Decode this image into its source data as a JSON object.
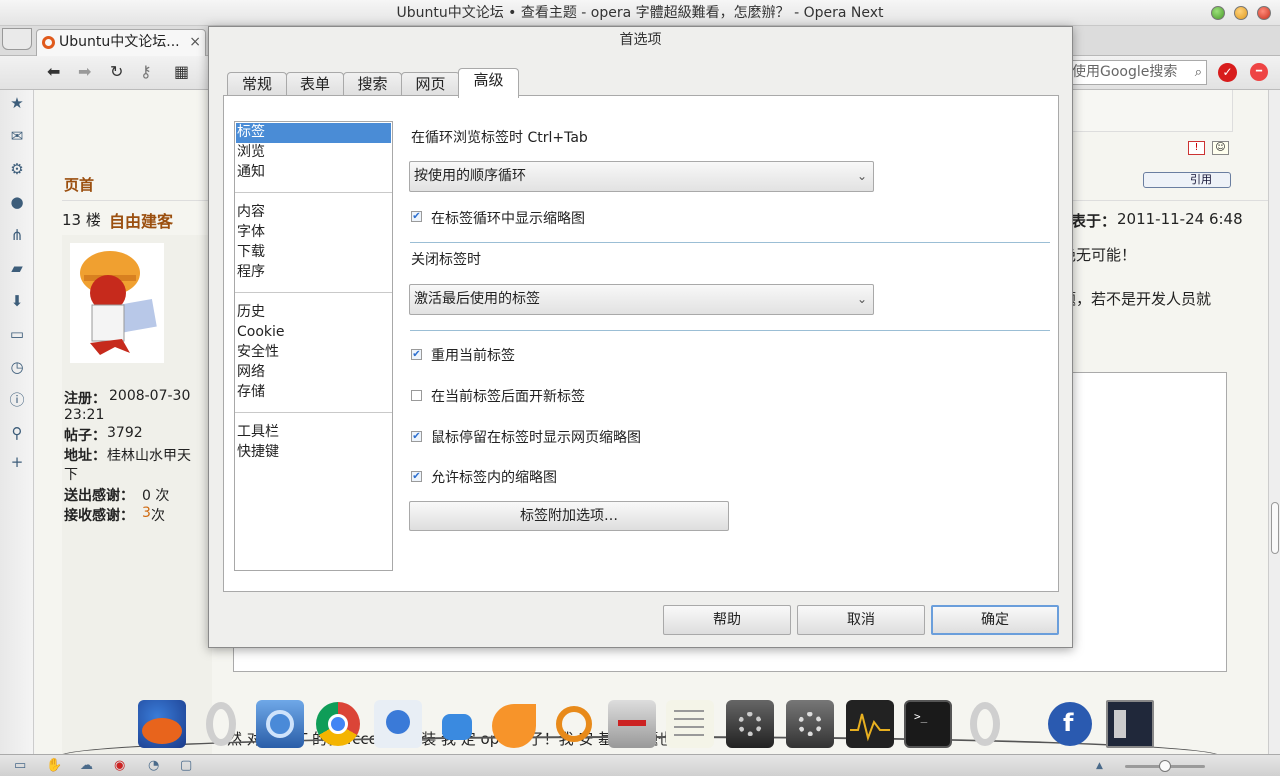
{
  "window": {
    "title": "Ubuntu中文论坛 • 查看主题 - opera 字體超級難看，怎麼辦？ - Opera Next"
  },
  "tab": {
    "label": "Ubuntu中文论坛...",
    "close": "×"
  },
  "toolbar": {
    "search_placeholder": "使用Google搜索"
  },
  "page": {
    "header_left": "页首",
    "quote_button": "引用",
    "floor": "13 楼",
    "author": "自由建客",
    "posted_label": "表于：",
    "posted_date": "2011-11-24 6:48",
    "body_line1": "绝无可能！",
    "body_line2": "题，若不是开发人员就",
    "bottom_text": "然       对       版      QT    的就     fcconfi          择       装      我      定      opera   了！我      安     基本问题也",
    "user": {
      "register_label": "注册：",
      "register_value": "2008-07-30",
      "register_time": "23:21",
      "posts_label": "帖子：",
      "posts_value": "3792",
      "address_label": "地址：",
      "address_value": "桂林山水甲天",
      "address_value2": "下",
      "thanks_given_label": "送出感谢：",
      "thanks_given_value": "0 次",
      "thanks_recv_label": "接收感谢：",
      "thanks_recv_value": "3",
      "thanks_recv_unit": " 次"
    }
  },
  "dialog": {
    "title": "首选项",
    "tabs": [
      "常规",
      "表单",
      "搜索",
      "网页",
      "高级"
    ],
    "active_tab": "高级",
    "categories": {
      "group1": [
        "标签",
        "浏览",
        "通知"
      ],
      "group2": [
        "内容",
        "字体",
        "下载",
        "程序"
      ],
      "group3": [
        "历史",
        "Cookie",
        "安全性",
        "网络",
        "存储"
      ],
      "group4": [
        "工具栏",
        "快捷键"
      ]
    },
    "selected_category": "标签",
    "cycle_label": "在循环浏览标签时 Ctrl+Tab",
    "cycle_select": "按使用的顺序循环",
    "show_thumbnails_cycle": {
      "label": "在标签循环中显示缩略图",
      "checked": true
    },
    "close_label": "关闭标签时",
    "close_select": "激活最后使用的标签",
    "checkboxes": [
      {
        "label": "重用当前标签",
        "checked": true
      },
      {
        "label": "在当前标签后面开新标签",
        "checked": false
      },
      {
        "label": "鼠标停留在标签时显示网页缩略图",
        "checked": true
      },
      {
        "label": "允许标签内的缩略图",
        "checked": true
      }
    ],
    "extra_button": "标签附加选项…",
    "help_button": "帮助",
    "cancel_button": "取消",
    "ok_button": "确定"
  },
  "dock": {
    "icons": [
      "firefox-icon",
      "opera-icon",
      "chromium-icon",
      "chrome-icon",
      "empathy-icon",
      "robot-icon",
      "orange-icon",
      "transmission-icon",
      "updown-icon",
      "text-editor-icon",
      "settings-icon",
      "settings2-icon",
      "system-monitor-icon",
      "terminal-icon",
      "opera2-icon",
      "fedora-icon",
      "workspace-icon"
    ]
  },
  "colors": {
    "accent": "#4a8cd6",
    "author": "#9b4f0f",
    "highlight_count": "#d06a10"
  }
}
